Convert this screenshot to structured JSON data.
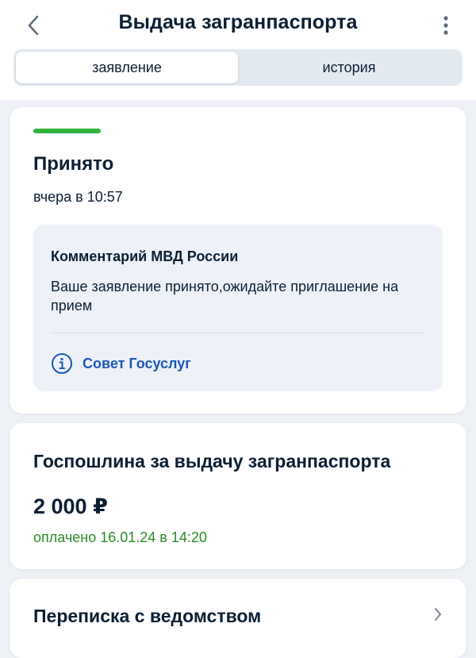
{
  "header": {
    "title": "Выдача загранпаспорта",
    "back_icon": "chevron-left-icon",
    "menu_icon": "more-vertical-icon"
  },
  "tabs": [
    {
      "label": "заявление",
      "active": true
    },
    {
      "label": "история",
      "active": false
    }
  ],
  "status": {
    "title": "Принято",
    "time": "вчера в 10:57",
    "accent_color": "#33b33e",
    "comment": {
      "title": "Комментарий МВД России",
      "text": "Ваше заявление принято,ожидайте приглашение на прием",
      "link_label": "Совет Госуслуг",
      "link_icon": "info-icon"
    }
  },
  "fee": {
    "title": "Госпошлина за выдачу загранпаспорта",
    "amount": "2 000 ₽",
    "status": "оплачено 16.01.24 в 14:20",
    "status_color": "#2b8a2b"
  },
  "correspondence": {
    "title": "Переписка с ведомством",
    "icon": "chevron-right-icon"
  }
}
